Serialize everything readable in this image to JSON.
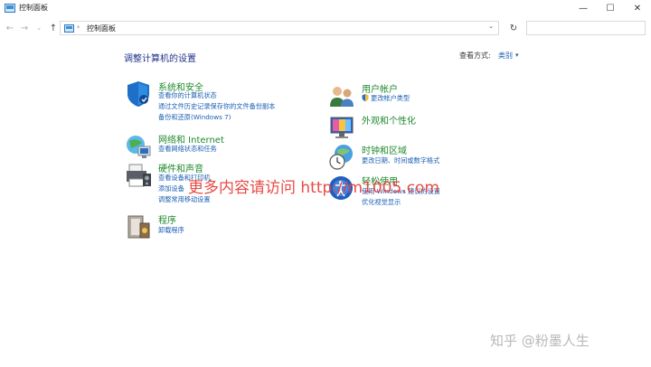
{
  "window": {
    "title": "控制面板",
    "minimize_glyph": "—",
    "maximize_glyph": "☐",
    "close_glyph": "✕"
  },
  "navigation": {
    "back_glyph": "←",
    "forward_glyph": "→",
    "recent_glyph": "⌄",
    "up_glyph": "↑",
    "breadcrumb_separator": "›",
    "address": "控制面板",
    "dropdown_glyph": "⌄",
    "refresh_glyph": "↻",
    "search_placeholder": ""
  },
  "main": {
    "heading": "调整计算机的设置",
    "view_by_label": "查看方式:",
    "view_by_value": "类别",
    "view_by_arrow": "▾"
  },
  "categories_left": [
    {
      "title": "系统和安全",
      "icon": "shield-icon",
      "links": [
        "查看你的计算机状态",
        "通过文件历史记录保存你的文件备份副本",
        "备份和还原(Windows 7)"
      ]
    },
    {
      "title": "网络和 Internet",
      "icon": "network-icon",
      "links": [
        "查看网络状态和任务"
      ]
    },
    {
      "title": "硬件和声音",
      "icon": "printer-icon",
      "links": [
        "查看设备和打印机",
        "添加设备",
        "调整常用移动设置"
      ]
    },
    {
      "title": "程序",
      "icon": "programs-icon",
      "links": [
        "卸载程序"
      ]
    }
  ],
  "categories_right": [
    {
      "title": "用户帐户",
      "icon": "users-icon",
      "links": [
        "更改帐户类型"
      ]
    },
    {
      "title": "外观和个性化",
      "icon": "appearance-icon",
      "links": []
    },
    {
      "title": "时钟和区域",
      "icon": "clock-globe-icon",
      "links": [
        "更改日期、时间或数字格式"
      ]
    },
    {
      "title": "轻松使用",
      "icon": "ease-of-access-icon",
      "links": [
        "使用 Windows 建议的设置",
        "优化视觉显示"
      ]
    }
  ],
  "overlays": {
    "watermark": "更多内容请访问 http://m1005.com",
    "zhihu_credit": "知乎 @粉墨人生"
  },
  "colors": {
    "heading": "#1e3287",
    "category_title": "#1f8a2e",
    "link": "#1a5fb4",
    "watermark": "#e8403a"
  }
}
